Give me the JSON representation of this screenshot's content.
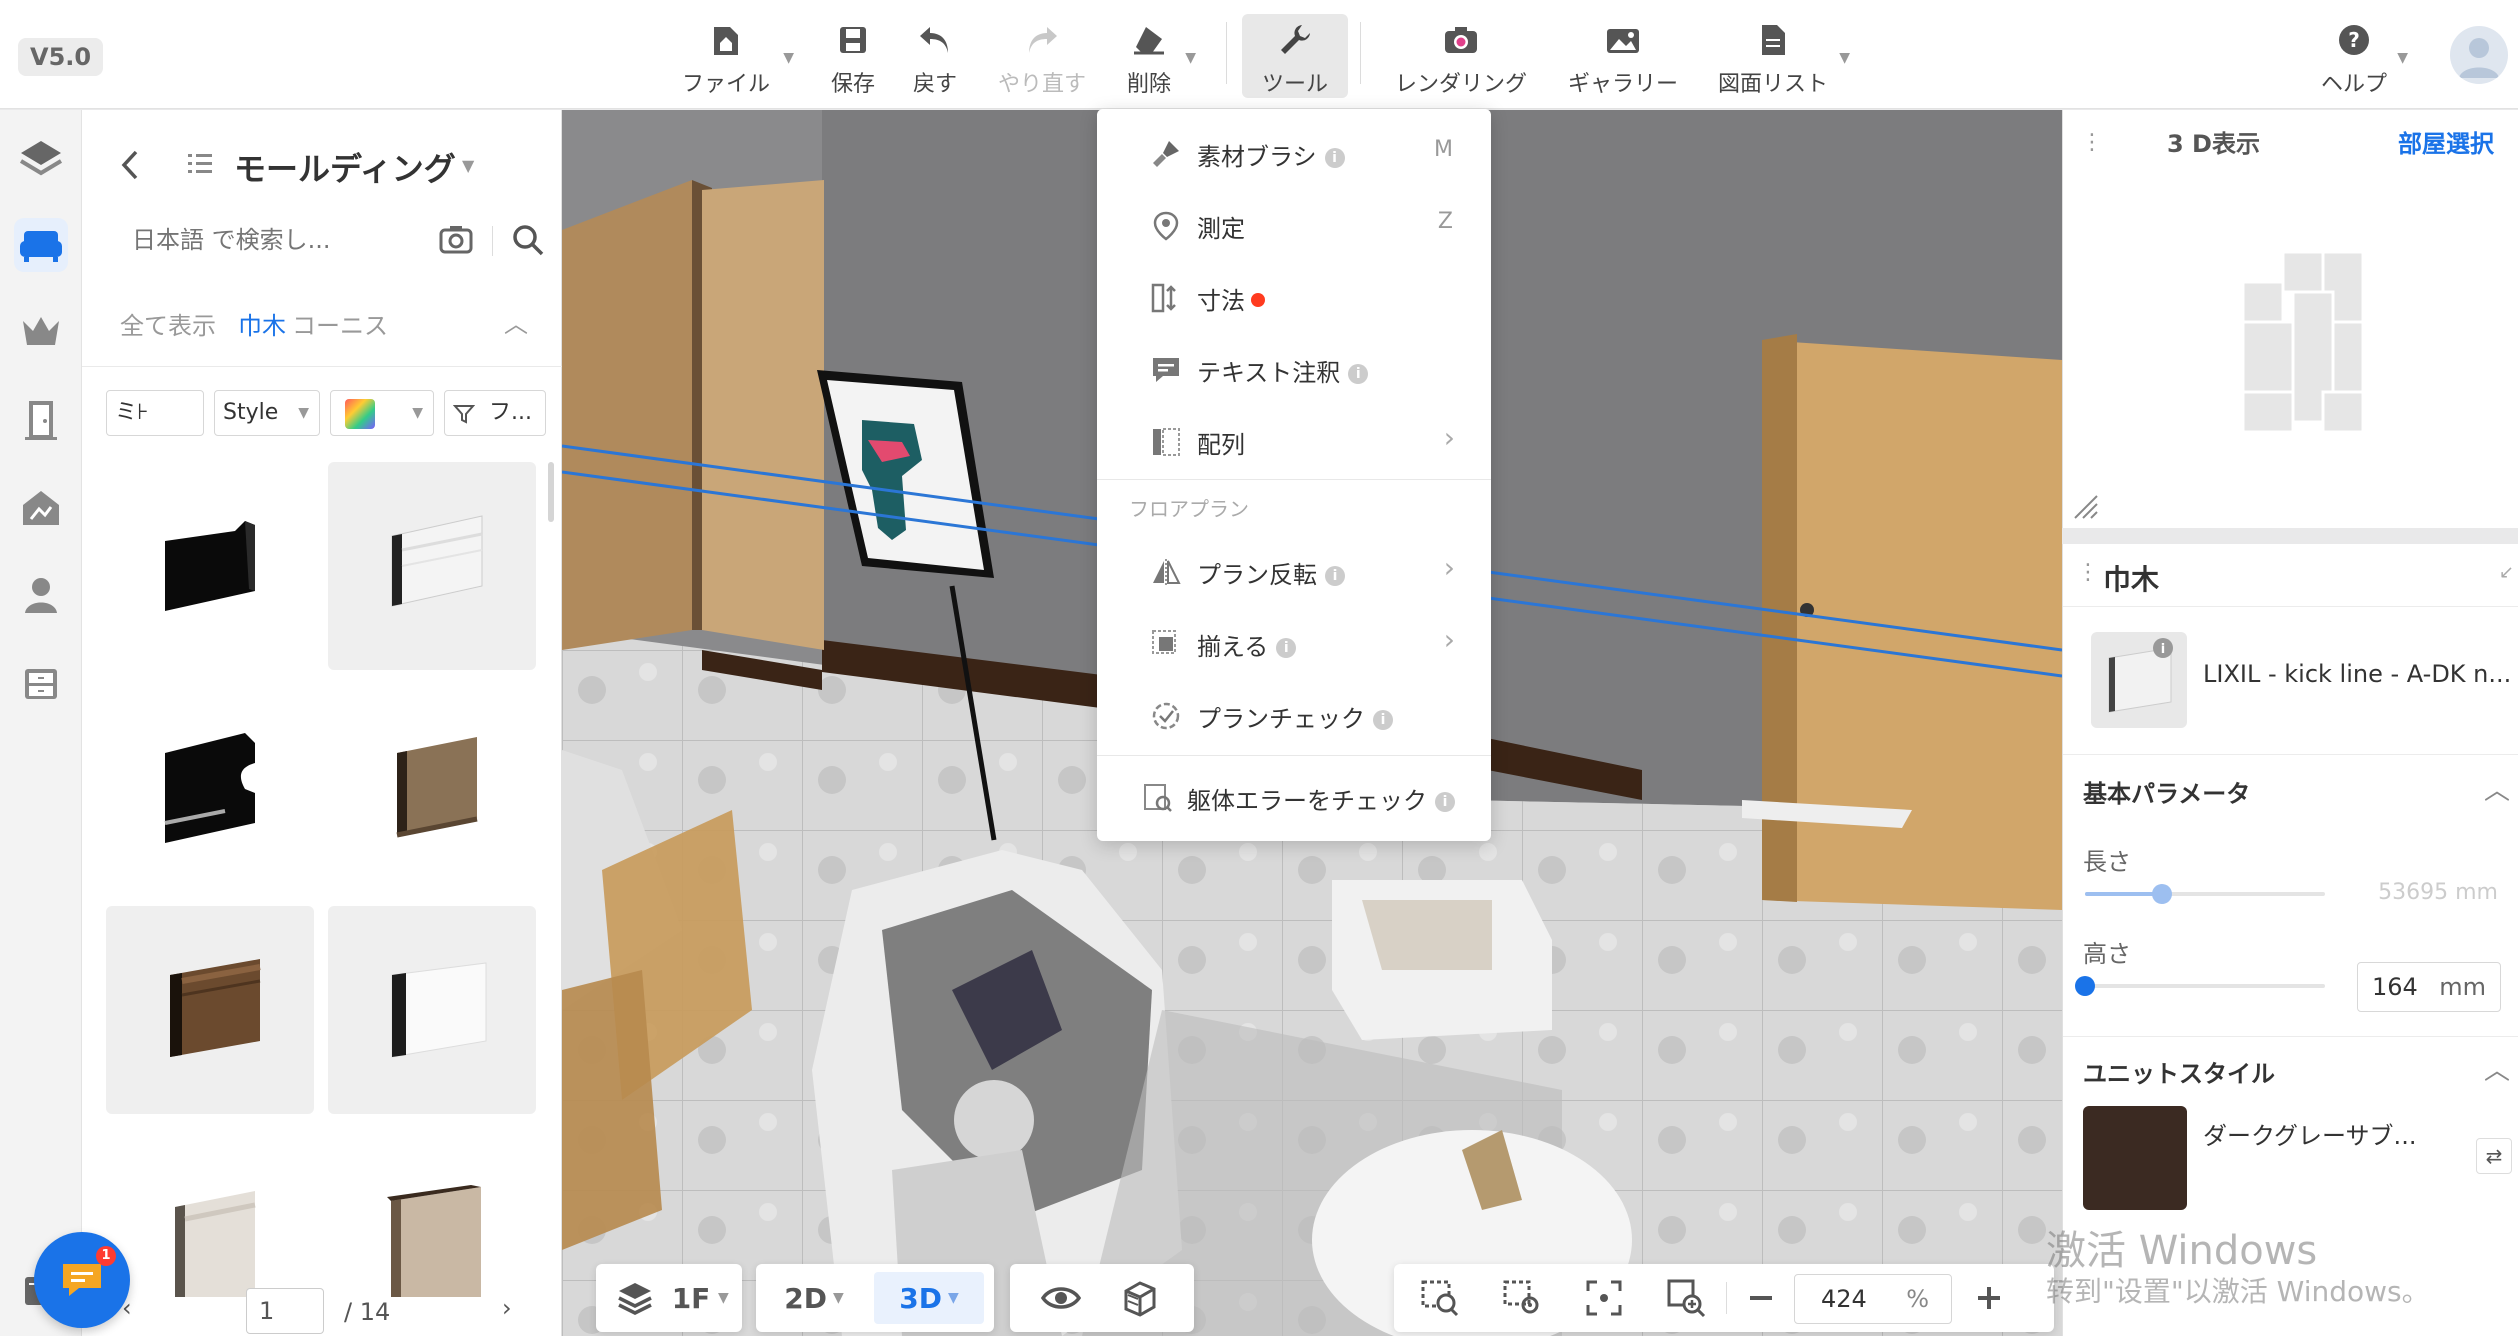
{
  "app": {
    "version": "V5.0"
  },
  "toolbar": {
    "file": "ファイル",
    "save": "保存",
    "undo": "戻す",
    "redo": "やり直す",
    "delete": "削除",
    "tools": "ツール",
    "rendering": "レンダリング",
    "gallery": "ギャラリー",
    "drawing_list": "図面リスト",
    "help": "ヘルプ"
  },
  "catalog": {
    "title": "モールディング",
    "search_placeholder": "日本語 で検索し...",
    "tabs": [
      "全て表示",
      "巾木",
      "コーニス"
    ],
    "active_tab": "巾木",
    "filters": {
      "first": "ミ⊦",
      "style": "Style",
      "filter": "フ..."
    },
    "pager": {
      "current": "1",
      "total": "/ 14"
    },
    "chat_badge": "1"
  },
  "tools_menu": {
    "items": [
      {
        "label": "素材ブラシ",
        "shortcut": "M",
        "info": true
      },
      {
        "label": "測定",
        "shortcut": "Z"
      },
      {
        "label": "寸法",
        "dot": true
      },
      {
        "label": "テキスト注釈",
        "info": true
      },
      {
        "label": "配列",
        "submenu": true
      }
    ],
    "section": "フロアプラン",
    "floor_items": [
      {
        "label": "プラン反転",
        "info": true,
        "submenu": true
      },
      {
        "label": "揃える",
        "info": true,
        "submenu": true
      },
      {
        "label": "プランチェック",
        "info": true
      }
    ],
    "footer": {
      "label": "躯体エラーをチェック",
      "info": true
    }
  },
  "minimap": {
    "title": "3 D表示",
    "room_select": "部屋選択"
  },
  "properties": {
    "title": "巾木",
    "item_name": "LIXIL - kick line - A-DK n...",
    "basic_params": "基本パラメータ",
    "length_label": "長さ",
    "length_value": "53695",
    "length_unit": "mm",
    "length_fraction": 0.32,
    "height_label": "高さ",
    "height_value": "164",
    "height_unit": "mm",
    "height_fraction": 0.0,
    "unit_style": "ユニットスタイル",
    "style_name": "ダークグレーサブ...",
    "colors": {
      "accent": "#1a73e8",
      "swatch": "#3b2a22"
    }
  },
  "bottom": {
    "floor": "1F",
    "view_2d": "2D",
    "view_3d": "3D",
    "zoom_value": "424",
    "zoom_unit": "%"
  },
  "watermark": {
    "line1": "激活 Windows",
    "line2": "转到\"设置\"以激活 Windows。"
  }
}
